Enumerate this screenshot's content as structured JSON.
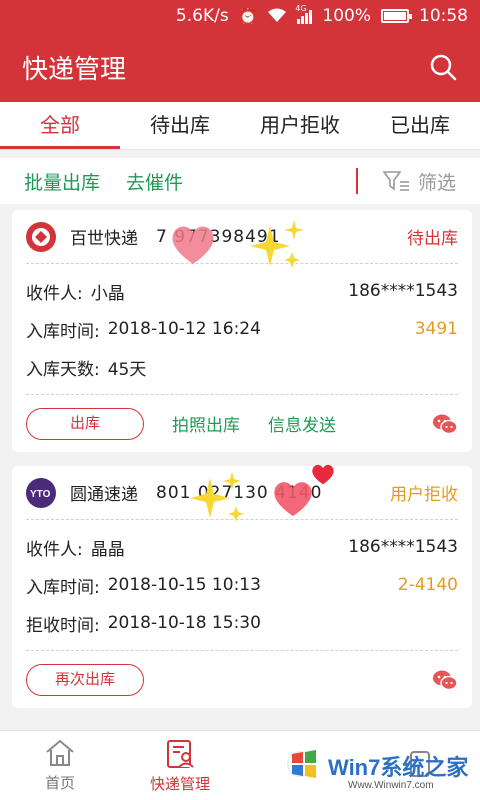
{
  "status_bar": {
    "speed": "5.6K/s",
    "network": "4G",
    "battery": "100%",
    "battery_level": 1.0,
    "time": "10:58"
  },
  "app_bar": {
    "title": "快递管理",
    "search_icon": "search-icon"
  },
  "tabs": [
    {
      "label": "全部",
      "active": true
    },
    {
      "label": "待出库",
      "active": false
    },
    {
      "label": "用户拒收",
      "active": false
    },
    {
      "label": "已出库",
      "active": false
    }
  ],
  "actions": {
    "batch_out": "批量出库",
    "urge": "去催件",
    "filter": "筛选"
  },
  "cards": [
    {
      "company": "百世快递",
      "tracking": "7 977398491",
      "status": "待出库",
      "status_color": "#d2343a",
      "recipient_label": "收件人:",
      "recipient": "小晶",
      "phone": "186****1543",
      "time_label": "入库时间:",
      "time": "2018-10-12 16:24",
      "code": "3491",
      "extra_label": "入库天数:",
      "extra": "45天",
      "button": "出库",
      "link1": "拍照出库",
      "link2": "信息发送"
    },
    {
      "company": "圆通速递",
      "tracking": "801 027130 4140",
      "status": "用户拒收",
      "status_color": "#e39d1d",
      "recipient_label": "收件人:",
      "recipient": "晶晶",
      "phone": "186****1543",
      "time_label": "入库时间:",
      "time": "2018-10-15 10:13",
      "code": "2-4140",
      "extra_label": "拒收时间:",
      "extra": "2018-10-18 15:30",
      "button": "再次出库"
    }
  ],
  "bottom_nav": [
    {
      "label": "首页",
      "active": false
    },
    {
      "label": "快递管理",
      "active": true
    },
    {
      "label": "",
      "active": false
    },
    {
      "label": "",
      "active": false
    }
  ],
  "watermark": {
    "text": "Win7系统之家",
    "url_text": "Www.Winwin7.com"
  },
  "colors": {
    "brand_red": "#d2343a",
    "green": "#1f9b57",
    "orange": "#e39d1d"
  }
}
